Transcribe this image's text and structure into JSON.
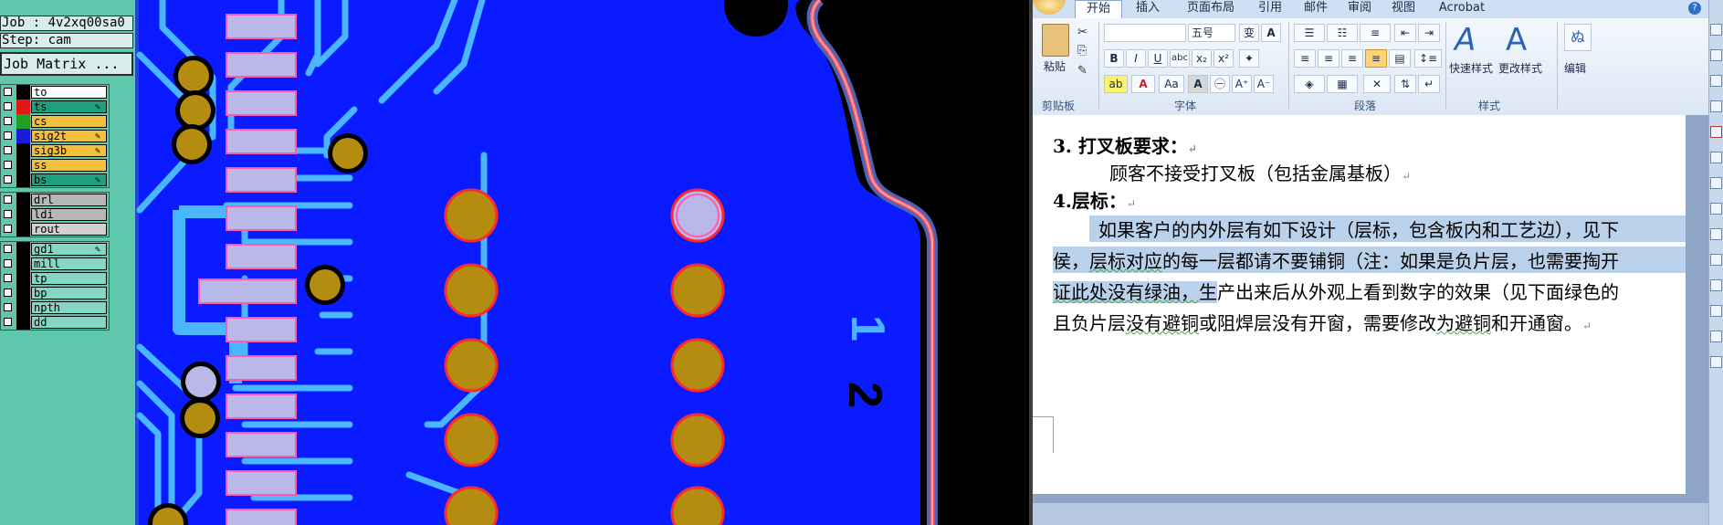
{
  "cam": {
    "job_label": "Job : 4v2xq00sa0",
    "step_label": "Step: cam",
    "job_matrix_button": "Job Matrix ...",
    "layer_groups": [
      [
        {
          "name": "to",
          "color": "#000000",
          "bg": "#ffffff",
          "marker": ""
        },
        {
          "name": "ts",
          "color": "#e01818",
          "bg": "#1ea080",
          "marker": "✎"
        },
        {
          "name": "cs",
          "color": "#1fa01f",
          "bg": "#f2c03a",
          "marker": ""
        },
        {
          "name": "sig2t",
          "color": "#1c1cd8",
          "bg": "#f2c03a",
          "marker": "✎"
        },
        {
          "name": "sig3b",
          "color": "#000000",
          "bg": "#f2c03a",
          "marker": "✎"
        },
        {
          "name": "ss",
          "color": "#000000",
          "bg": "#f2c03a",
          "marker": ""
        },
        {
          "name": "bs",
          "color": "#000000",
          "bg": "#1ea080",
          "marker": "✎"
        }
      ],
      [
        {
          "name": "drl",
          "color": "#000000",
          "bg": "#b6b6b6",
          "marker": ""
        },
        {
          "name": "ldi",
          "color": "#000000",
          "bg": "#b6b6b6",
          "marker": ""
        },
        {
          "name": "rout",
          "color": "#000000",
          "bg": "#d0d0d0",
          "marker": ""
        }
      ],
      [
        {
          "name": "gd1",
          "color": "#000000",
          "bg": "#86d6c6",
          "marker": "✎"
        },
        {
          "name": "mill",
          "color": "#000000",
          "bg": "#86d6c6",
          "marker": ""
        },
        {
          "name": "tp",
          "color": "#000000",
          "bg": "#86d6c6",
          "marker": ""
        },
        {
          "name": "bp",
          "color": "#000000",
          "bg": "#86d6c6",
          "marker": ""
        },
        {
          "name": "npth",
          "color": "#000000",
          "bg": "#86d6c6",
          "marker": ""
        },
        {
          "name": "dd",
          "color": "#000000",
          "bg": "#86d6c6",
          "marker": ""
        }
      ]
    ],
    "board_text": [
      "1",
      "2"
    ],
    "colors": {
      "board": "#0a1cff",
      "trace": "#49b6ff",
      "pad": "#b9b8e8",
      "via": "#b48c10",
      "outline": "#ff2a2a"
    }
  },
  "word": {
    "tabs": [
      "开始",
      "插入",
      "页面布局",
      "引用",
      "邮件",
      "审阅",
      "视图",
      "Acrobat"
    ],
    "ribbon": {
      "paste_label": "粘贴",
      "font_size": "五号",
      "groups": [
        "剪贴板",
        "字体",
        "段落",
        "样式"
      ],
      "quick_style_label": "快速样式",
      "change_style_label": "更改样式",
      "edit_label": "编辑"
    },
    "doc": {
      "l1_num": "3.",
      "l1_text": "打叉板要求：",
      "l2_text": "顾客不接受打叉板（包括金属基板）",
      "l3_text": "4.层标：",
      "l4_text": "如果客户的内外层有如下设计（层标，包含板内和工艺边），见下",
      "l5a": "侯，",
      "l5b": "层标对应",
      "l5c": "的每一层都请不要铺铜（注：如果是负片层，也需要掏开",
      "l6a": "证此处没有绿油，",
      "l6b": "生",
      "l6c": "产出来后从外观上看到数字的效果（见下面绿色的",
      "l7a": "且负片层",
      "l7b": "没有避铜",
      "l7c": "或阻焊层没有开窗，需要修改",
      "l7d": "为避铜",
      "l7e": "和开通窗。",
      "para_mark": "↵"
    }
  }
}
